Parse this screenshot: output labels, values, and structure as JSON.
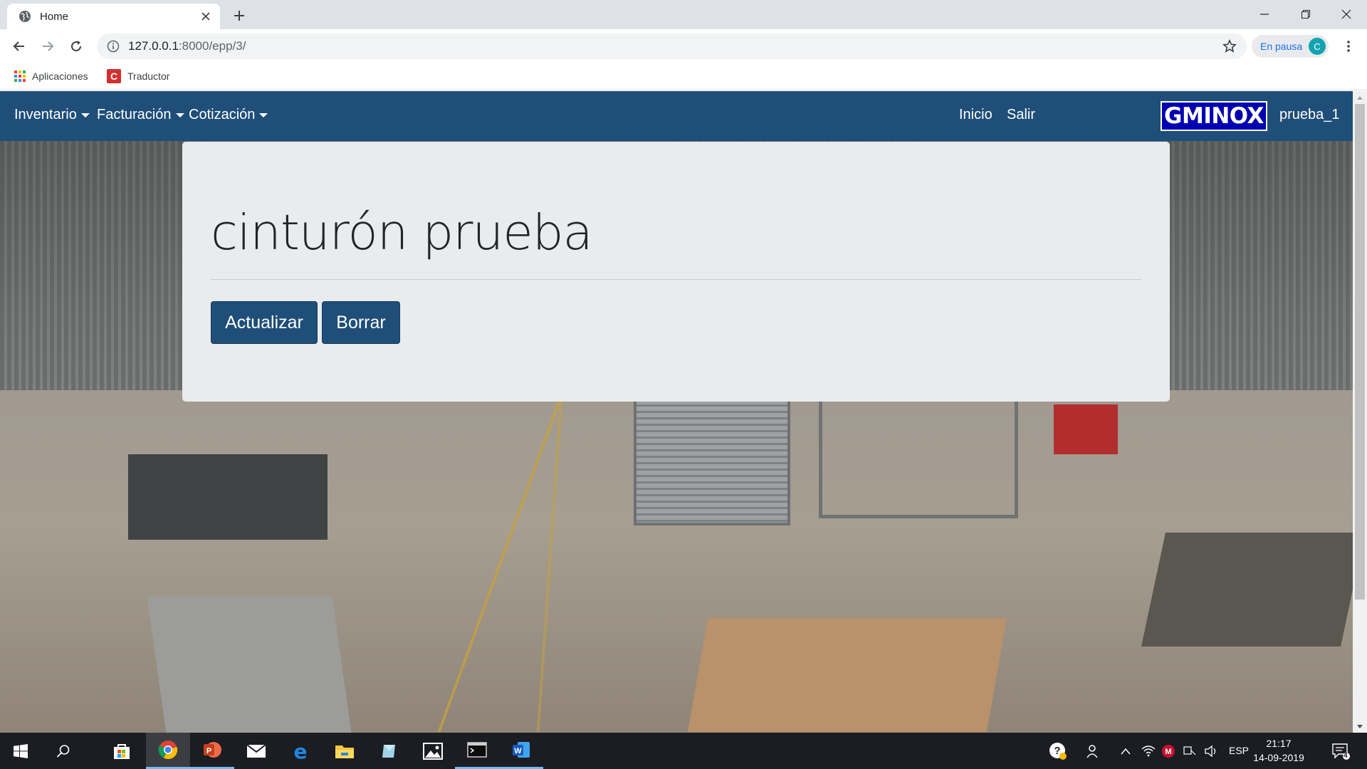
{
  "browser": {
    "tab_title": "Home",
    "url_host": "127.0.0.1",
    "url_path": ":8000/epp/3/",
    "profile_label": "En pausa",
    "profile_initial": "C",
    "bookmarks": [
      "Aplicaciones",
      "Traductor"
    ]
  },
  "navbar": {
    "menus": [
      "Inventario",
      "Facturación",
      "Cotización"
    ],
    "links": [
      "Inicio",
      "Salir"
    ],
    "brand": "GMINOX",
    "user": "prueba_1"
  },
  "card": {
    "title": "cinturón prueba",
    "update_label": "Actualizar",
    "delete_label": "Borrar"
  },
  "taskbar": {
    "lang": "ESP",
    "time": "21:17",
    "date": "14-09-2019",
    "notifications": "4"
  },
  "colors": {
    "navbar": "#1f4e79",
    "button": "#1f4e79",
    "card_bg": "#e9ecef",
    "brand_bg": "#0000b0"
  },
  "icons": [
    "globe-icon",
    "close-icon",
    "plus-icon",
    "minimize-icon",
    "restore-icon",
    "back-icon",
    "forward-icon",
    "reload-icon",
    "info-icon",
    "star-icon",
    "kebab-menu-icon",
    "apps-icon",
    "translator-icon",
    "windows-start-icon",
    "search-icon",
    "store-icon",
    "chrome-icon",
    "powerpoint-icon",
    "mail-icon",
    "edge-icon",
    "file-explorer-icon",
    "photos-icon",
    "terminal-icon",
    "word-icon",
    "help-icon",
    "people-icon",
    "wifi-icon",
    "volume-icon",
    "notification-icon"
  ]
}
